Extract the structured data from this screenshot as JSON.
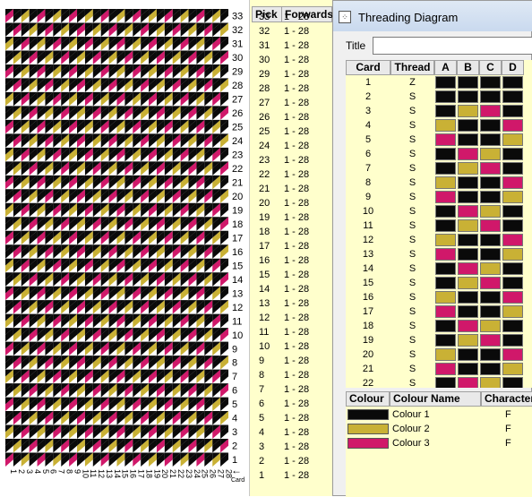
{
  "colors": {
    "black": "#0a0a0a",
    "gold": "#c9b135",
    "magenta": "#d0186a"
  },
  "pattern": {
    "pick_labels": [
      "33",
      "32",
      "31",
      "30",
      "29",
      "28",
      "27",
      "26",
      "25",
      "24",
      "23",
      "22",
      "21",
      "20",
      "19",
      "18",
      "17",
      "16",
      "15",
      "14",
      "13",
      "12",
      "11",
      "10",
      "9",
      "8",
      "7",
      "6",
      "5",
      "4",
      "3",
      "2",
      "1"
    ],
    "card_labels": [
      "1",
      "2",
      "3",
      "4",
      "5",
      "6",
      "7",
      "8",
      "9",
      "10",
      "11",
      "12",
      "13",
      "14",
      "15",
      "16",
      "17",
      "18",
      "19",
      "20",
      "21",
      "22",
      "23",
      "24",
      "25",
      "26",
      "27",
      "28"
    ],
    "card_axis_label": "Card"
  },
  "pick_table": {
    "headers": {
      "pick": "Pick",
      "forwards": "Forwards"
    },
    "rows": [
      {
        "pick": "33",
        "fwd": "1 - 28"
      },
      {
        "pick": "32",
        "fwd": "1 - 28"
      },
      {
        "pick": "31",
        "fwd": "1 - 28"
      },
      {
        "pick": "30",
        "fwd": "1 - 28"
      },
      {
        "pick": "29",
        "fwd": "1 - 28"
      },
      {
        "pick": "28",
        "fwd": "1 - 28"
      },
      {
        "pick": "27",
        "fwd": "1 - 28"
      },
      {
        "pick": "26",
        "fwd": "1 - 28"
      },
      {
        "pick": "25",
        "fwd": "1 - 28"
      },
      {
        "pick": "24",
        "fwd": "1 - 28"
      },
      {
        "pick": "23",
        "fwd": "1 - 28"
      },
      {
        "pick": "22",
        "fwd": "1 - 28"
      },
      {
        "pick": "21",
        "fwd": "1 - 28"
      },
      {
        "pick": "20",
        "fwd": "1 - 28"
      },
      {
        "pick": "19",
        "fwd": "1 - 28"
      },
      {
        "pick": "18",
        "fwd": "1 - 28"
      },
      {
        "pick": "17",
        "fwd": "1 - 28"
      },
      {
        "pick": "16",
        "fwd": "1 - 28"
      },
      {
        "pick": "15",
        "fwd": "1 - 28"
      },
      {
        "pick": "14",
        "fwd": "1 - 28"
      },
      {
        "pick": "13",
        "fwd": "1 - 28"
      },
      {
        "pick": "12",
        "fwd": "1 - 28"
      },
      {
        "pick": "11",
        "fwd": "1 - 28"
      },
      {
        "pick": "10",
        "fwd": "1 - 28"
      },
      {
        "pick": "9",
        "fwd": "1 - 28"
      },
      {
        "pick": "8",
        "fwd": "1 - 28"
      },
      {
        "pick": "7",
        "fwd": "1 - 28"
      },
      {
        "pick": "6",
        "fwd": "1 - 28"
      },
      {
        "pick": "5",
        "fwd": "1 - 28"
      },
      {
        "pick": "4",
        "fwd": "1 - 28"
      },
      {
        "pick": "3",
        "fwd": "1 - 28"
      },
      {
        "pick": "2",
        "fwd": "1 - 28"
      },
      {
        "pick": "1",
        "fwd": "1 - 28"
      }
    ]
  },
  "window": {
    "title": "Threading Diagram",
    "title_field_label": "Title",
    "title_field_value": ""
  },
  "threading": {
    "headers": {
      "card": "Card",
      "thread": "Thread",
      "a": "A",
      "b": "B",
      "c": "C",
      "d": "D"
    },
    "rows": [
      {
        "card": "1",
        "thread": "Z",
        "holes": [
          "black",
          "black",
          "black",
          "black"
        ]
      },
      {
        "card": "2",
        "thread": "S",
        "holes": [
          "black",
          "black",
          "black",
          "black"
        ]
      },
      {
        "card": "3",
        "thread": "S",
        "holes": [
          "black",
          "gold",
          "magenta",
          "black"
        ]
      },
      {
        "card": "4",
        "thread": "S",
        "holes": [
          "gold",
          "black",
          "black",
          "magenta"
        ]
      },
      {
        "card": "5",
        "thread": "S",
        "holes": [
          "magenta",
          "black",
          "black",
          "gold"
        ]
      },
      {
        "card": "6",
        "thread": "S",
        "holes": [
          "black",
          "magenta",
          "gold",
          "black"
        ]
      },
      {
        "card": "7",
        "thread": "S",
        "holes": [
          "black",
          "gold",
          "magenta",
          "black"
        ]
      },
      {
        "card": "8",
        "thread": "S",
        "holes": [
          "gold",
          "black",
          "black",
          "magenta"
        ]
      },
      {
        "card": "9",
        "thread": "S",
        "holes": [
          "magenta",
          "black",
          "black",
          "gold"
        ]
      },
      {
        "card": "10",
        "thread": "S",
        "holes": [
          "black",
          "magenta",
          "gold",
          "black"
        ]
      },
      {
        "card": "11",
        "thread": "S",
        "holes": [
          "black",
          "gold",
          "magenta",
          "black"
        ]
      },
      {
        "card": "12",
        "thread": "S",
        "holes": [
          "gold",
          "black",
          "black",
          "magenta"
        ]
      },
      {
        "card": "13",
        "thread": "S",
        "holes": [
          "magenta",
          "black",
          "black",
          "gold"
        ]
      },
      {
        "card": "14",
        "thread": "S",
        "holes": [
          "black",
          "magenta",
          "gold",
          "black"
        ]
      },
      {
        "card": "15",
        "thread": "S",
        "holes": [
          "black",
          "gold",
          "magenta",
          "black"
        ]
      },
      {
        "card": "16",
        "thread": "S",
        "holes": [
          "gold",
          "black",
          "black",
          "magenta"
        ]
      },
      {
        "card": "17",
        "thread": "S",
        "holes": [
          "magenta",
          "black",
          "black",
          "gold"
        ]
      },
      {
        "card": "18",
        "thread": "S",
        "holes": [
          "black",
          "magenta",
          "gold",
          "black"
        ]
      },
      {
        "card": "19",
        "thread": "S",
        "holes": [
          "black",
          "gold",
          "magenta",
          "black"
        ]
      },
      {
        "card": "20",
        "thread": "S",
        "holes": [
          "gold",
          "black",
          "black",
          "magenta"
        ]
      },
      {
        "card": "21",
        "thread": "S",
        "holes": [
          "magenta",
          "black",
          "black",
          "gold"
        ]
      },
      {
        "card": "22",
        "thread": "S",
        "holes": [
          "black",
          "magenta",
          "gold",
          "black"
        ]
      }
    ]
  },
  "colours": {
    "headers": {
      "colour": "Colour",
      "name": "Colour Name",
      "character": "Character"
    },
    "rows": [
      {
        "swatch": "black",
        "name": "Colour 1",
        "char": "F"
      },
      {
        "swatch": "gold",
        "name": "Colour 2",
        "char": "F"
      },
      {
        "swatch": "magenta",
        "name": "Colour 3",
        "char": "F"
      }
    ]
  }
}
